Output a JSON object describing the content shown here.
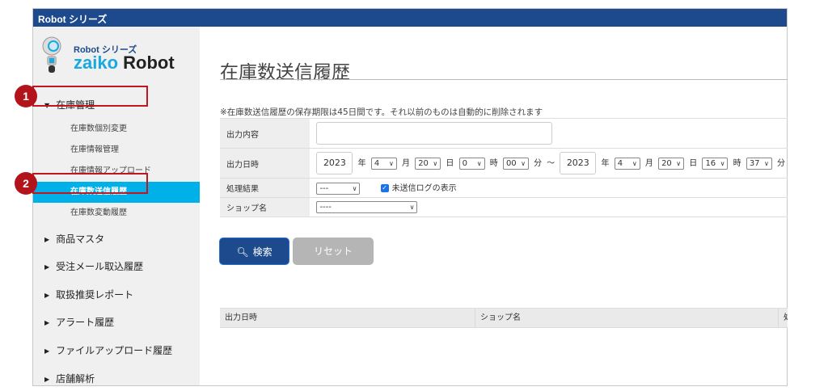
{
  "window": {
    "title": "Robot シリーズ"
  },
  "logo": {
    "series": "Robot シリーズ",
    "brand_a": "zaiko",
    "brand_b": "Robot"
  },
  "sidebar": {
    "group": {
      "label": "在庫管理",
      "items": [
        {
          "label": "在庫数個別変更"
        },
        {
          "label": "在庫情報管理"
        },
        {
          "label": "在庫情報アップロード"
        },
        {
          "label": "在庫数送信履歴",
          "active": true
        },
        {
          "label": "在庫数変動履歴"
        }
      ]
    },
    "items": [
      {
        "label": "商品マスタ"
      },
      {
        "label": "受注メール取込履歴"
      },
      {
        "label": "取扱推奨レポート"
      },
      {
        "label": "アラート履歴"
      },
      {
        "label": "ファイルアップロード履歴"
      },
      {
        "label": "店舗解析"
      }
    ]
  },
  "annotations": [
    {
      "label": "1"
    },
    {
      "label": "2"
    }
  ],
  "page": {
    "title": "在庫数送信履歴",
    "note": "※在庫数送信履歴の保存期限は45日間です。それ以前のものは自動的に削除されます"
  },
  "form": {
    "output_content": {
      "label": "出力内容",
      "value": ""
    },
    "output_datetime": {
      "label": "出力日時",
      "from": {
        "year": "2023",
        "month": "4",
        "day": "20",
        "hour": "0",
        "minute": "00"
      },
      "to": {
        "year": "2023",
        "month": "4",
        "day": "20",
        "hour": "16",
        "minute": "37"
      },
      "units": {
        "year": "年",
        "month": "月",
        "day": "日",
        "hour": "時",
        "minute": "分",
        "range": "〜"
      }
    },
    "result": {
      "label": "処理結果",
      "value": "---",
      "checkbox_label": "未送信ログの表示",
      "checked": true
    },
    "shop": {
      "label": "ショップ名",
      "value": "----"
    }
  },
  "buttons": {
    "search": "検索",
    "reset": "リセット"
  },
  "results": {
    "columns": [
      "出力日時",
      "ショップ名",
      "処"
    ]
  },
  "colors": {
    "header": "#1c4a8c",
    "active": "#00b0e8",
    "annotation": "#b3141c"
  }
}
